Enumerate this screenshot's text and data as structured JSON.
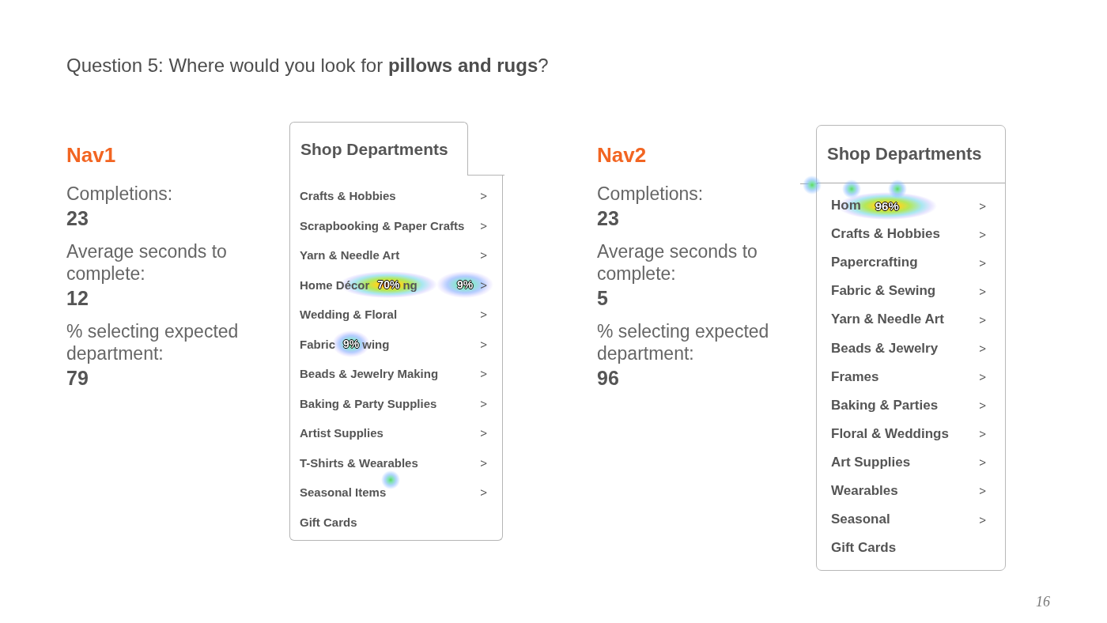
{
  "question": "Question 5: Where would you look for **pillows and rugs**?",
  "navs": [
    {
      "name": "Nav1",
      "stats": [
        {
          "label": "Completions:",
          "value": "23"
        },
        {
          "label": "Average seconds to complete:",
          "value": "12"
        },
        {
          "label": "% selecting expected department:",
          "value": "79"
        }
      ],
      "menu": {
        "kind": "tab",
        "title": "Shop Departments",
        "items": [
          {
            "label": "Crafts & Hobbies",
            "arrow": ">"
          },
          {
            "label": "Scrapbooking & Paper Crafts",
            "arrow": ">"
          },
          {
            "label": "Yarn & Needle Art",
            "arrow": ">"
          },
          {
            "label": "Home Décor",
            "heat": {
              "label": "70%",
              "kind": "hot"
            },
            "label_end": "ng",
            "arrow_heat": {
              "label": "9%",
              "kind": "cool"
            },
            "arrow": ">"
          },
          {
            "label": "Wedding & Floral",
            "arrow": ">"
          },
          {
            "label": "Fabric",
            "heat": {
              "label": "9%",
              "kind": "cool"
            },
            "label_end": "wing",
            "arrow": ">"
          },
          {
            "label": "Beads & Jewelry Making",
            "arrow": ">"
          },
          {
            "label": "Baking & Party Supplies",
            "arrow": ">"
          },
          {
            "label": "Artist Supplies",
            "arrow": ">"
          },
          {
            "label": "T-Shirts & Wearables",
            "arrow": ">"
          },
          {
            "label": "Seasonal Items",
            "arrow": ">"
          },
          {
            "label": "Gift Cards"
          }
        ]
      }
    },
    {
      "name": "Nav2",
      "stats": [
        {
          "label": "Completions:",
          "value": "23"
        },
        {
          "label": "Average seconds to complete:",
          "value": "5"
        },
        {
          "label": "% selecting expected department:",
          "value": "96"
        }
      ],
      "menu": {
        "kind": "box",
        "title": "Shop Departments",
        "items": [
          {
            "label": "Hom",
            "heat": {
              "label": "96%",
              "kind": "hot"
            },
            "arrow": ">"
          },
          {
            "label": "Crafts & Hobbies",
            "arrow": ">"
          },
          {
            "label": "Papercrafting",
            "arrow": ">"
          },
          {
            "label": "Fabric & Sewing",
            "arrow": ">"
          },
          {
            "label": "Yarn & Needle Art",
            "arrow": ">"
          },
          {
            "label": "Beads & Jewelry",
            "arrow": ">"
          },
          {
            "label": "Frames",
            "arrow": ">"
          },
          {
            "label": "Baking & Parties",
            "arrow": ">"
          },
          {
            "label": "Floral & Weddings",
            "arrow": ">"
          },
          {
            "label": "Art Supplies",
            "arrow": ">"
          },
          {
            "label": "Wearables",
            "arrow": ">"
          },
          {
            "label": "Seasonal",
            "arrow": ">"
          },
          {
            "label": "Gift Cards"
          }
        ]
      }
    }
  ],
  "page_number": "16"
}
